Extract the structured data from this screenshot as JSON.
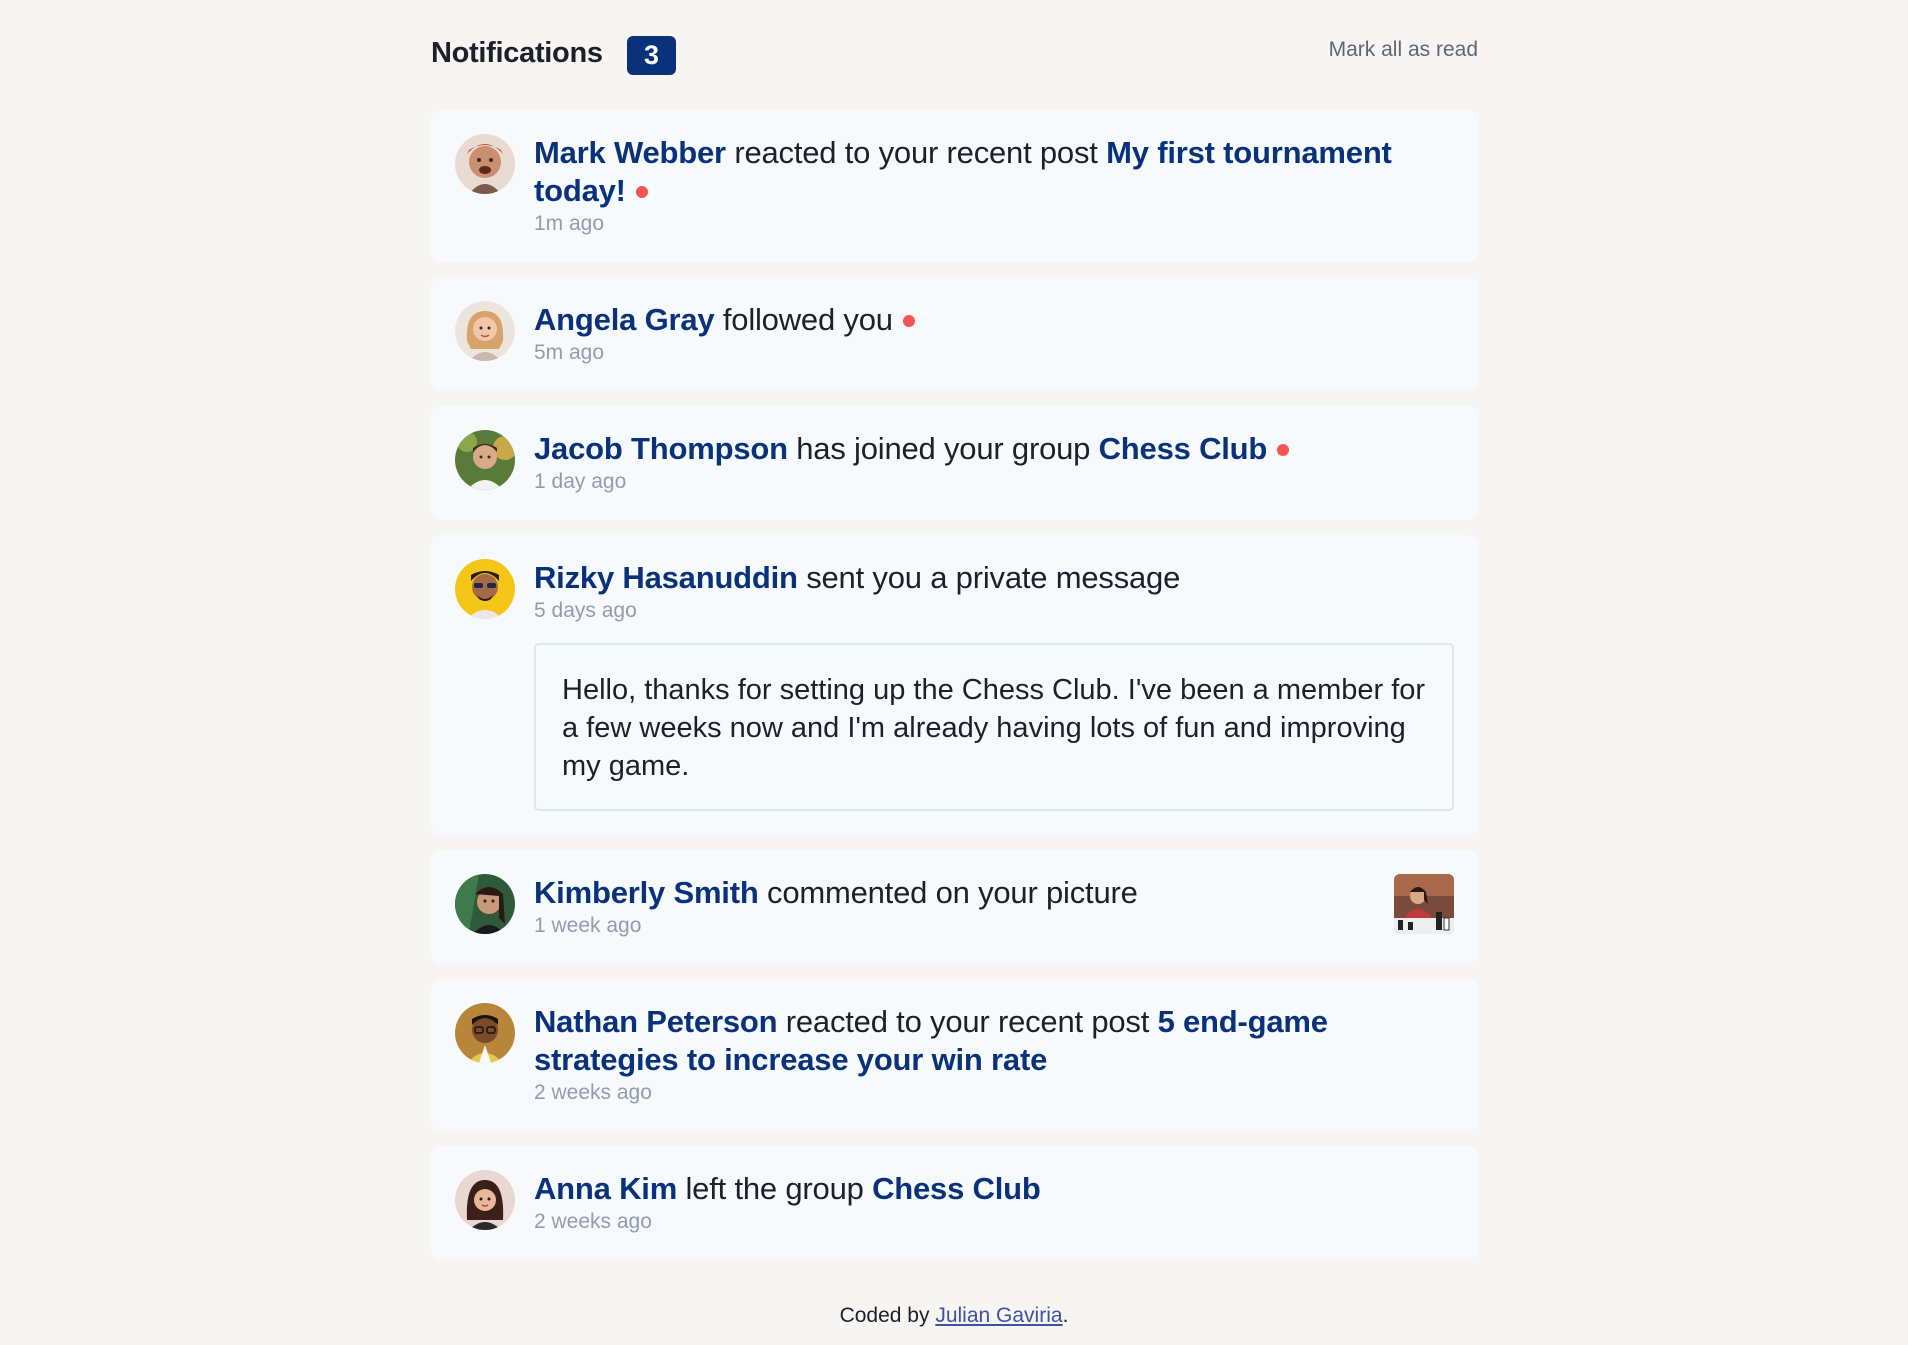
{
  "header": {
    "title": "Notifications",
    "unread_count": "3",
    "mark_all_label": "Mark all as read"
  },
  "notifications": [
    {
      "name": "Mark Webber",
      "action": "reacted to your recent post",
      "target": "My first tournament today!",
      "unread": true,
      "time": "1m ago",
      "avatar_icon": "avatar-mark-webber"
    },
    {
      "name": "Angela Gray",
      "action": "followed you",
      "target": "",
      "unread": true,
      "time": "5m ago",
      "avatar_icon": "avatar-angela-gray"
    },
    {
      "name": "Jacob Thompson",
      "action": "has joined your group",
      "target": "Chess Club",
      "unread": true,
      "time": "1 day ago",
      "avatar_icon": "avatar-jacob-thompson"
    },
    {
      "name": "Rizky Hasanuddin",
      "action": "sent you a private message",
      "target": "",
      "unread": false,
      "time": "5 days ago",
      "message": "Hello, thanks for setting up the Chess Club. I've been a member for a few weeks now and I'm already having lots of fun and improving my game.",
      "avatar_icon": "avatar-rizky-hasanuddin"
    },
    {
      "name": "Kimberly Smith",
      "action": "commented on your picture",
      "target": "",
      "unread": false,
      "time": "1 week ago",
      "picture_icon": "chess-picture-thumbnail",
      "avatar_icon": "avatar-kimberly-smith"
    },
    {
      "name": "Nathan Peterson",
      "action": "reacted to your recent post",
      "target": "5 end-game strategies to increase your win rate",
      "unread": false,
      "time": "2 weeks ago",
      "avatar_icon": "avatar-nathan-peterson"
    },
    {
      "name": "Anna Kim",
      "action": "left the group",
      "target": "Chess Club",
      "unread": false,
      "time": "2 weeks ago",
      "avatar_icon": "avatar-anna-kim"
    }
  ],
  "footer": {
    "prefix": "Coded by",
    "author": "Julian Gaviria",
    "suffix": "."
  },
  "colors": {
    "page_bg": "#f7f5f2",
    "card_bg": "#f7fafd",
    "brand_blue": "#0a327b",
    "unread_dot": "#f65552",
    "muted_text": "#939cad"
  }
}
